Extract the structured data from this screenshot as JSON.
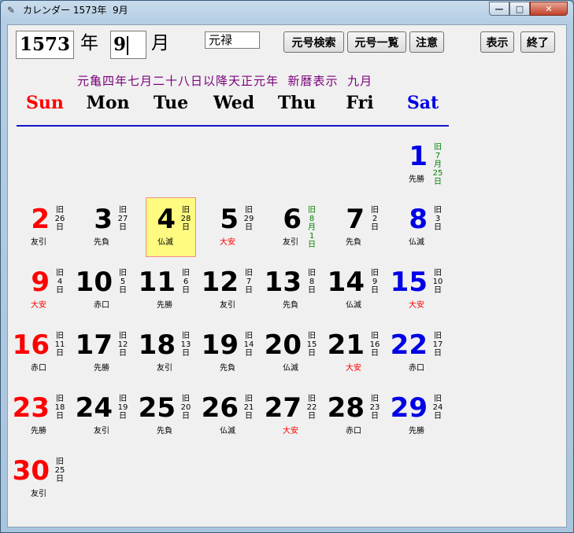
{
  "window": {
    "title": "カレンダー 1573年  9月",
    "minimize_glyph": "—",
    "maximize_glyph": "□",
    "close_glyph": "✕"
  },
  "toolbar": {
    "year_value": "1573",
    "year_unit": "年",
    "month_value": "9",
    "month_unit": "月",
    "era_value": "元禄",
    "era_search_label": "元号検索",
    "era_list_label": "元号一覧",
    "notice_label": "注意",
    "show_label": "表示",
    "exit_label": "終了"
  },
  "banner": "元亀四年七月二十八日以降天正元年  新暦表示  九月",
  "weekdays": [
    {
      "label": "Sun",
      "color": "#ff0000"
    },
    {
      "label": "Mon",
      "color": "#000000"
    },
    {
      "label": "Tue",
      "color": "#000000"
    },
    {
      "label": "Wed",
      "color": "#000000"
    },
    {
      "label": "Thu",
      "color": "#000000"
    },
    {
      "label": "Fri",
      "color": "#000000"
    },
    {
      "label": "Sat",
      "color": "#0000e6"
    }
  ],
  "colors": {
    "sunday": "#ff0000",
    "saturday": "#0000e6",
    "weekday": "#000000",
    "old_month_start": "#008000",
    "taian": "#ff0000",
    "rokuyo": "#000000"
  },
  "days": [
    {
      "day": "1",
      "dow": 6,
      "week": 0,
      "old": [
        "旧",
        "7",
        "月",
        "25",
        "日"
      ],
      "old_green": true,
      "rokuyo": "先勝"
    },
    {
      "day": "2",
      "dow": 0,
      "week": 1,
      "old": [
        "旧",
        "26",
        "日"
      ],
      "rokuyo": "友引"
    },
    {
      "day": "3",
      "dow": 1,
      "week": 1,
      "old": [
        "旧",
        "27",
        "日"
      ],
      "rokuyo": "先負"
    },
    {
      "day": "4",
      "dow": 2,
      "week": 1,
      "old": [
        "旧",
        "28",
        "日"
      ],
      "rokuyo": "仏滅",
      "today": true
    },
    {
      "day": "5",
      "dow": 3,
      "week": 1,
      "old": [
        "旧",
        "29",
        "日"
      ],
      "rokuyo": "大安"
    },
    {
      "day": "6",
      "dow": 4,
      "week": 1,
      "old": [
        "旧",
        "8",
        "月",
        "1",
        "日"
      ],
      "old_green": true,
      "rokuyo": "友引"
    },
    {
      "day": "7",
      "dow": 5,
      "week": 1,
      "old": [
        "旧",
        "2",
        "日"
      ],
      "rokuyo": "先負"
    },
    {
      "day": "8",
      "dow": 6,
      "week": 1,
      "old": [
        "旧",
        "3",
        "日"
      ],
      "rokuyo": "仏滅"
    },
    {
      "day": "9",
      "dow": 0,
      "week": 2,
      "old": [
        "旧",
        "4",
        "日"
      ],
      "rokuyo": "大安"
    },
    {
      "day": "10",
      "dow": 1,
      "week": 2,
      "old": [
        "旧",
        "5",
        "日"
      ],
      "rokuyo": "赤口"
    },
    {
      "day": "11",
      "dow": 2,
      "week": 2,
      "old": [
        "旧",
        "6",
        "日"
      ],
      "rokuyo": "先勝"
    },
    {
      "day": "12",
      "dow": 3,
      "week": 2,
      "old": [
        "旧",
        "7",
        "日"
      ],
      "rokuyo": "友引"
    },
    {
      "day": "13",
      "dow": 4,
      "week": 2,
      "old": [
        "旧",
        "8",
        "日"
      ],
      "rokuyo": "先負"
    },
    {
      "day": "14",
      "dow": 5,
      "week": 2,
      "old": [
        "旧",
        "9",
        "日"
      ],
      "rokuyo": "仏滅"
    },
    {
      "day": "15",
      "dow": 6,
      "week": 2,
      "old": [
        "旧",
        "10",
        "日"
      ],
      "rokuyo": "大安"
    },
    {
      "day": "16",
      "dow": 0,
      "week": 3,
      "old": [
        "旧",
        "11",
        "日"
      ],
      "rokuyo": "赤口"
    },
    {
      "day": "17",
      "dow": 1,
      "week": 3,
      "old": [
        "旧",
        "12",
        "日"
      ],
      "rokuyo": "先勝"
    },
    {
      "day": "18",
      "dow": 2,
      "week": 3,
      "old": [
        "旧",
        "13",
        "日"
      ],
      "rokuyo": "友引"
    },
    {
      "day": "19",
      "dow": 3,
      "week": 3,
      "old": [
        "旧",
        "14",
        "日"
      ],
      "rokuyo": "先負"
    },
    {
      "day": "20",
      "dow": 4,
      "week": 3,
      "old": [
        "旧",
        "15",
        "日"
      ],
      "rokuyo": "仏滅"
    },
    {
      "day": "21",
      "dow": 5,
      "week": 3,
      "old": [
        "旧",
        "16",
        "日"
      ],
      "rokuyo": "大安"
    },
    {
      "day": "22",
      "dow": 6,
      "week": 3,
      "old": [
        "旧",
        "17",
        "日"
      ],
      "rokuyo": "赤口"
    },
    {
      "day": "23",
      "dow": 0,
      "week": 4,
      "old": [
        "旧",
        "18",
        "日"
      ],
      "rokuyo": "先勝"
    },
    {
      "day": "24",
      "dow": 1,
      "week": 4,
      "old": [
        "旧",
        "19",
        "日"
      ],
      "rokuyo": "友引"
    },
    {
      "day": "25",
      "dow": 2,
      "week": 4,
      "old": [
        "旧",
        "20",
        "日"
      ],
      "rokuyo": "先負"
    },
    {
      "day": "26",
      "dow": 3,
      "week": 4,
      "old": [
        "旧",
        "21",
        "日"
      ],
      "rokuyo": "仏滅"
    },
    {
      "day": "27",
      "dow": 4,
      "week": 4,
      "old": [
        "旧",
        "22",
        "日"
      ],
      "rokuyo": "大安"
    },
    {
      "day": "28",
      "dow": 5,
      "week": 4,
      "old": [
        "旧",
        "23",
        "日"
      ],
      "rokuyo": "赤口"
    },
    {
      "day": "29",
      "dow": 6,
      "week": 4,
      "old": [
        "旧",
        "24",
        "日"
      ],
      "rokuyo": "先勝"
    },
    {
      "day": "30",
      "dow": 0,
      "week": 5,
      "old": [
        "旧",
        "25",
        "日"
      ],
      "rokuyo": "友引"
    }
  ]
}
